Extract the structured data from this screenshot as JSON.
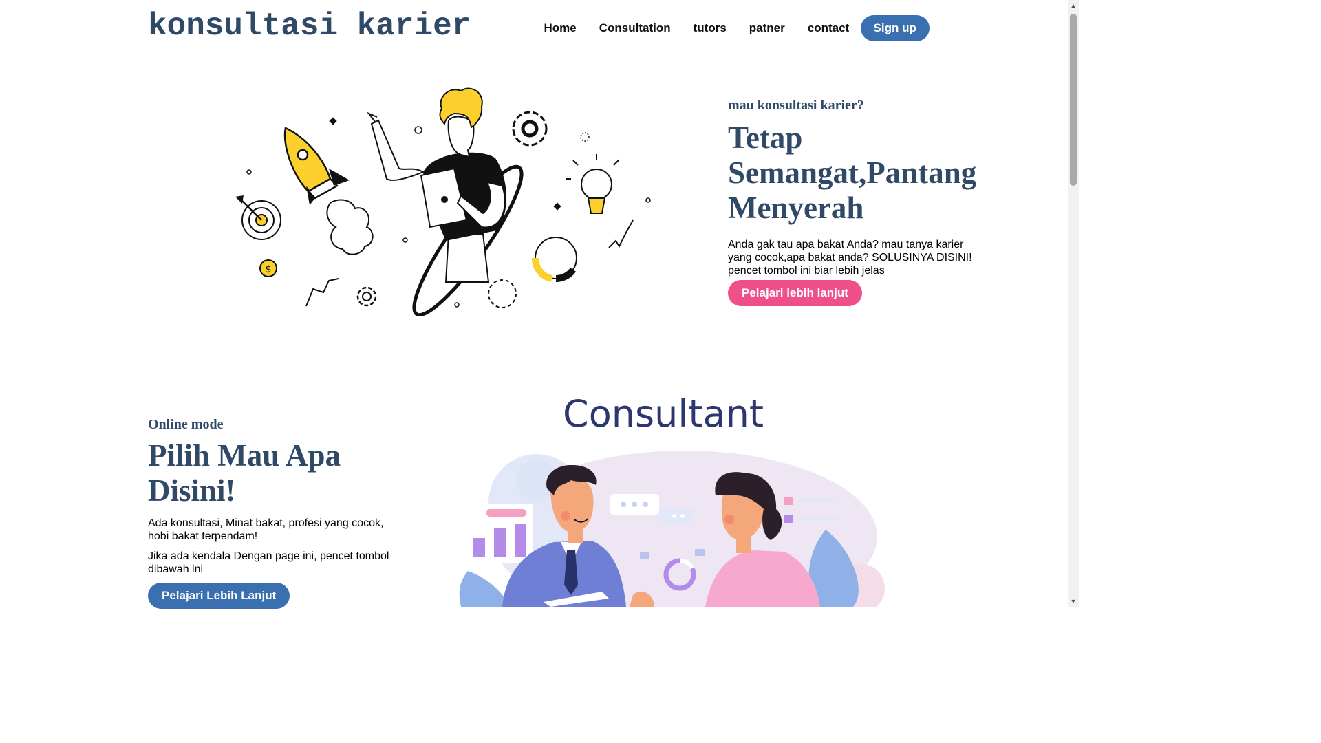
{
  "header": {
    "logo": "konsultasi karier",
    "nav": [
      "Home",
      "Consultation",
      "tutors",
      "patner",
      "contact"
    ],
    "signup_label": "Sign up"
  },
  "hero": {
    "eyebrow": "mau konsultasi karier?",
    "title": "Tetap Semangat,Pantang Menyerah",
    "description": "Anda gak tau apa bakat Anda? mau tanya karier yang cocok,apa bakat anda? SOLUSINYA DISINI! pencet tombol ini biar lebih jelas",
    "button_label": "Pelajari lebih lanjut"
  },
  "section2": {
    "eyebrow": "Online mode",
    "title": "Pilih Mau Apa Disini!",
    "paragraph1": "Ada konsultasi, Minat bakat, profesi yang cocok, hobi bakat terpendam!",
    "paragraph2": "Jika ada kendala Dengan page ini, pencet tombol dibawah ini",
    "button_label": "Pelajari Lebih Lanjut",
    "illustration_title": "Consultant"
  },
  "colors": {
    "brand": "#2f4966",
    "accent_blue": "#3a6fb0",
    "accent_pink": "#f0508a",
    "illustration_yellow": "#fbd02c",
    "consult_navy": "#2e3670"
  }
}
